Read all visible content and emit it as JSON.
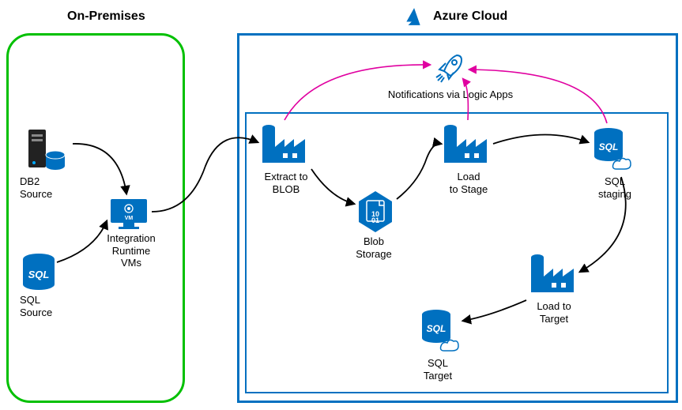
{
  "zones": {
    "onprem_title": "On-Premises",
    "azure_title": "Azure Cloud"
  },
  "nodes": {
    "db2_source": "DB2\nSource",
    "sql_source": "SQL\nSource",
    "integration_runtime": "Integration\nRuntime\nVMs",
    "extract_blob": "Extract to\nBLOB",
    "blob_storage": "Blob\nStorage",
    "load_stage": "Load\nto Stage",
    "sql_staging": "SQL\nstaging",
    "load_target": "Load to\nTarget",
    "sql_target": "SQL\nTarget",
    "notifications": "Notifications via Logic Apps"
  },
  "colors": {
    "azure_blue": "#0070c0",
    "green": "#00c000",
    "magenta": "#e000a0",
    "black": "#000000"
  }
}
